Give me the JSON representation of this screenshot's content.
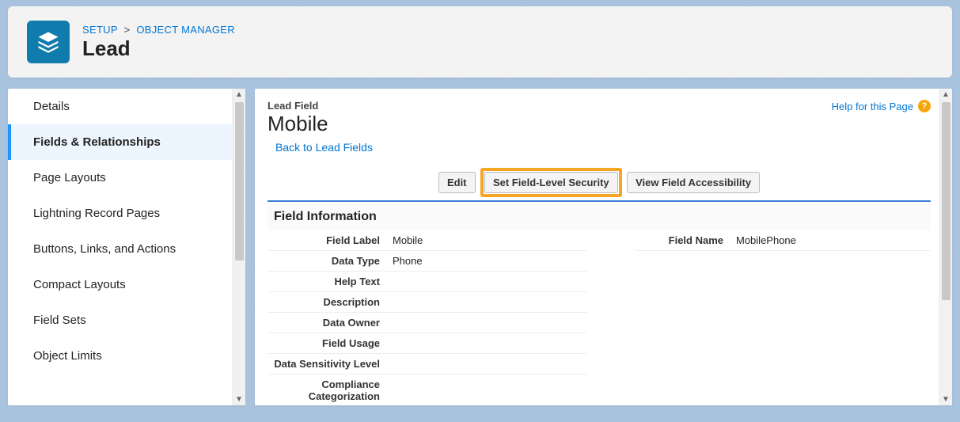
{
  "header": {
    "breadcrumb_setup": "SETUP",
    "breadcrumb_sep": ">",
    "breadcrumb_object_manager": "OBJECT MANAGER",
    "title": "Lead"
  },
  "sidebar": {
    "items": [
      {
        "label": "Details"
      },
      {
        "label": "Fields & Relationships"
      },
      {
        "label": "Page Layouts"
      },
      {
        "label": "Lightning Record Pages"
      },
      {
        "label": "Buttons, Links, and Actions"
      },
      {
        "label": "Compact Layouts"
      },
      {
        "label": "Field Sets"
      },
      {
        "label": "Object Limits"
      }
    ]
  },
  "main": {
    "eyebrow": "Lead Field",
    "title": "Mobile",
    "back_link": "Back to Lead Fields",
    "help_link": "Help for this Page",
    "help_icon": "?",
    "buttons": {
      "edit": "Edit",
      "set_fls": "Set Field-Level Security",
      "view_access": "View Field Accessibility"
    },
    "section_title": "Field Information",
    "details": {
      "field_label_lbl": "Field Label",
      "field_label_val": "Mobile",
      "field_name_lbl": "Field Name",
      "field_name_val": "MobilePhone",
      "data_type_lbl": "Data Type",
      "data_type_val": "Phone",
      "help_text_lbl": "Help Text",
      "help_text_val": "",
      "description_lbl": "Description",
      "description_val": "",
      "data_owner_lbl": "Data Owner",
      "data_owner_val": "",
      "field_usage_lbl": "Field Usage",
      "field_usage_val": "",
      "data_sensitivity_lbl": "Data Sensitivity Level",
      "data_sensitivity_val": "",
      "compliance_lbl": "Compliance Categorization",
      "compliance_val": ""
    }
  }
}
